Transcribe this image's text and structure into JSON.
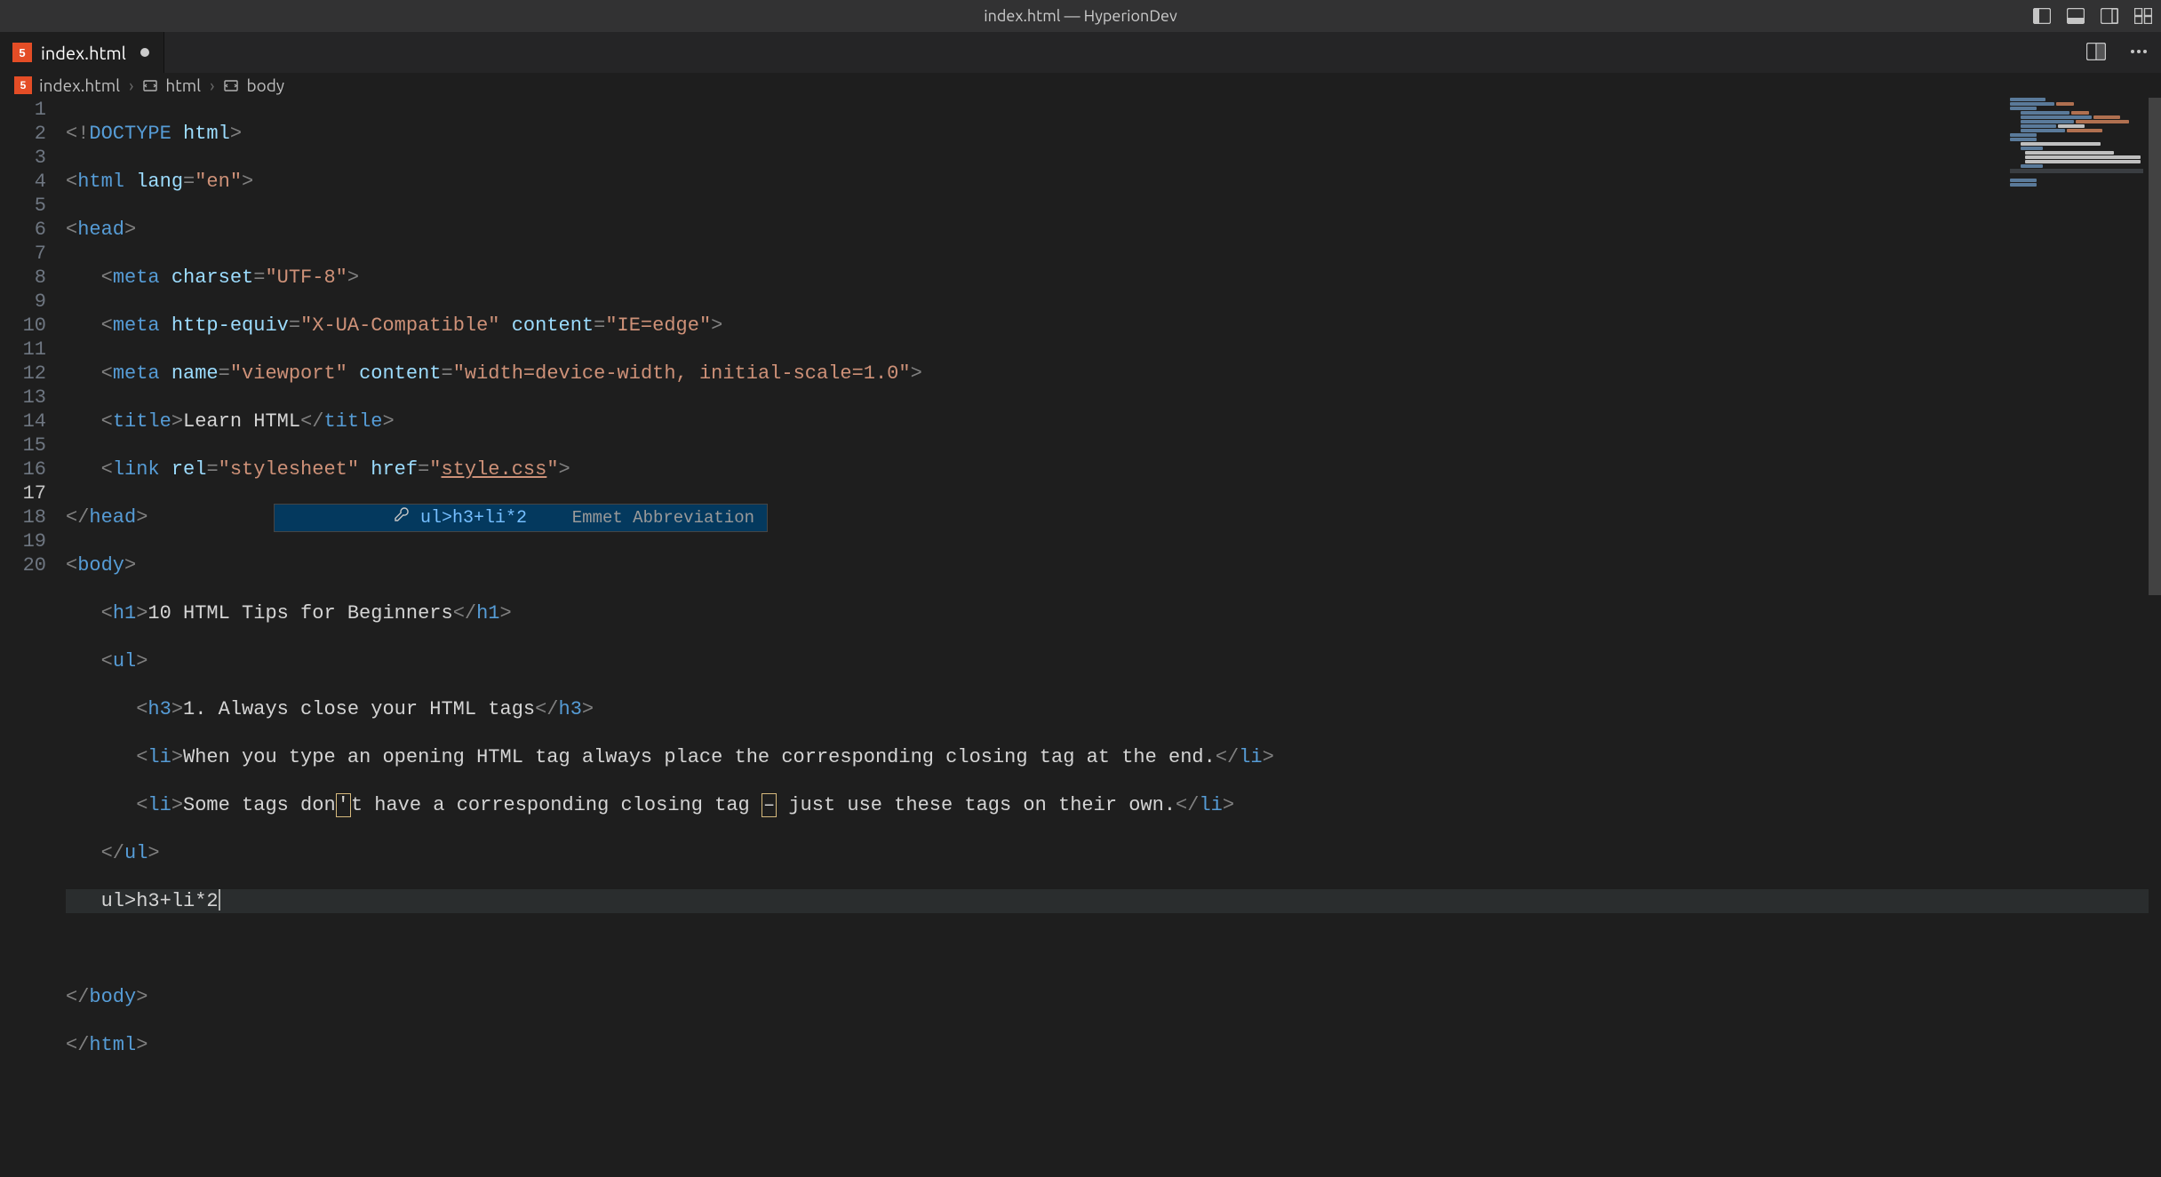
{
  "window": {
    "title": "index.html — HyperionDev"
  },
  "tab": {
    "filename": "index.html",
    "dirty": true
  },
  "breadcrumbs": {
    "items": [
      "index.html",
      "html",
      "body"
    ]
  },
  "suggest": {
    "label": "ul>h3+li*2",
    "kind": "Emmet Abbreviation"
  },
  "code": {
    "lines_total": 20,
    "current_line": 17,
    "line1_doctype": "DOCTYPE",
    "line1_html": "html",
    "line2_tag": "html",
    "line2_attr": "lang",
    "line2_val": "\"en\"",
    "line3_tag": "head",
    "line4_tag": "meta",
    "line4_a1": "charset",
    "line4_v1": "\"UTF-8\"",
    "line5_tag": "meta",
    "line5_a1": "http-equiv",
    "line5_v1": "\"X-UA-Compatible\"",
    "line5_a2": "content",
    "line5_v2": "\"IE=edge\"",
    "line6_tag": "meta",
    "line6_a1": "name",
    "line6_v1": "\"viewport\"",
    "line6_a2": "content",
    "line6_v2": "\"width=device-width, initial-scale=1.0\"",
    "line7_tag": "title",
    "line7_text": "Learn HTML",
    "line8_tag": "link",
    "line8_a1": "rel",
    "line8_v1": "\"stylesheet\"",
    "line8_a2": "href",
    "line8_v2a": "\"",
    "line8_v2b": "style.css",
    "line8_v2c": "\"",
    "line9_tag": "head",
    "line10_tag": "body",
    "line11_tag": "h1",
    "line11_text": "10 HTML Tips for Beginners",
    "line12_tag": "ul",
    "line13_tag": "h3",
    "line13_text": "1. Always close your HTML tags",
    "line14_tag": "li",
    "line14_text": "When you type an opening HTML tag always place the corresponding closing tag at the end.",
    "line15_tag": "li",
    "line15_t1": "Some tags don",
    "line15_box1": "'",
    "line15_t2": "t have a corresponding closing tag ",
    "line15_box2": "–",
    "line15_t3": " just use these tags on their own.",
    "line16_tag": "ul",
    "line17_text": "ul>h3+li*2",
    "line18_text": "",
    "line19_tag": "body",
    "line20_tag": "html"
  }
}
